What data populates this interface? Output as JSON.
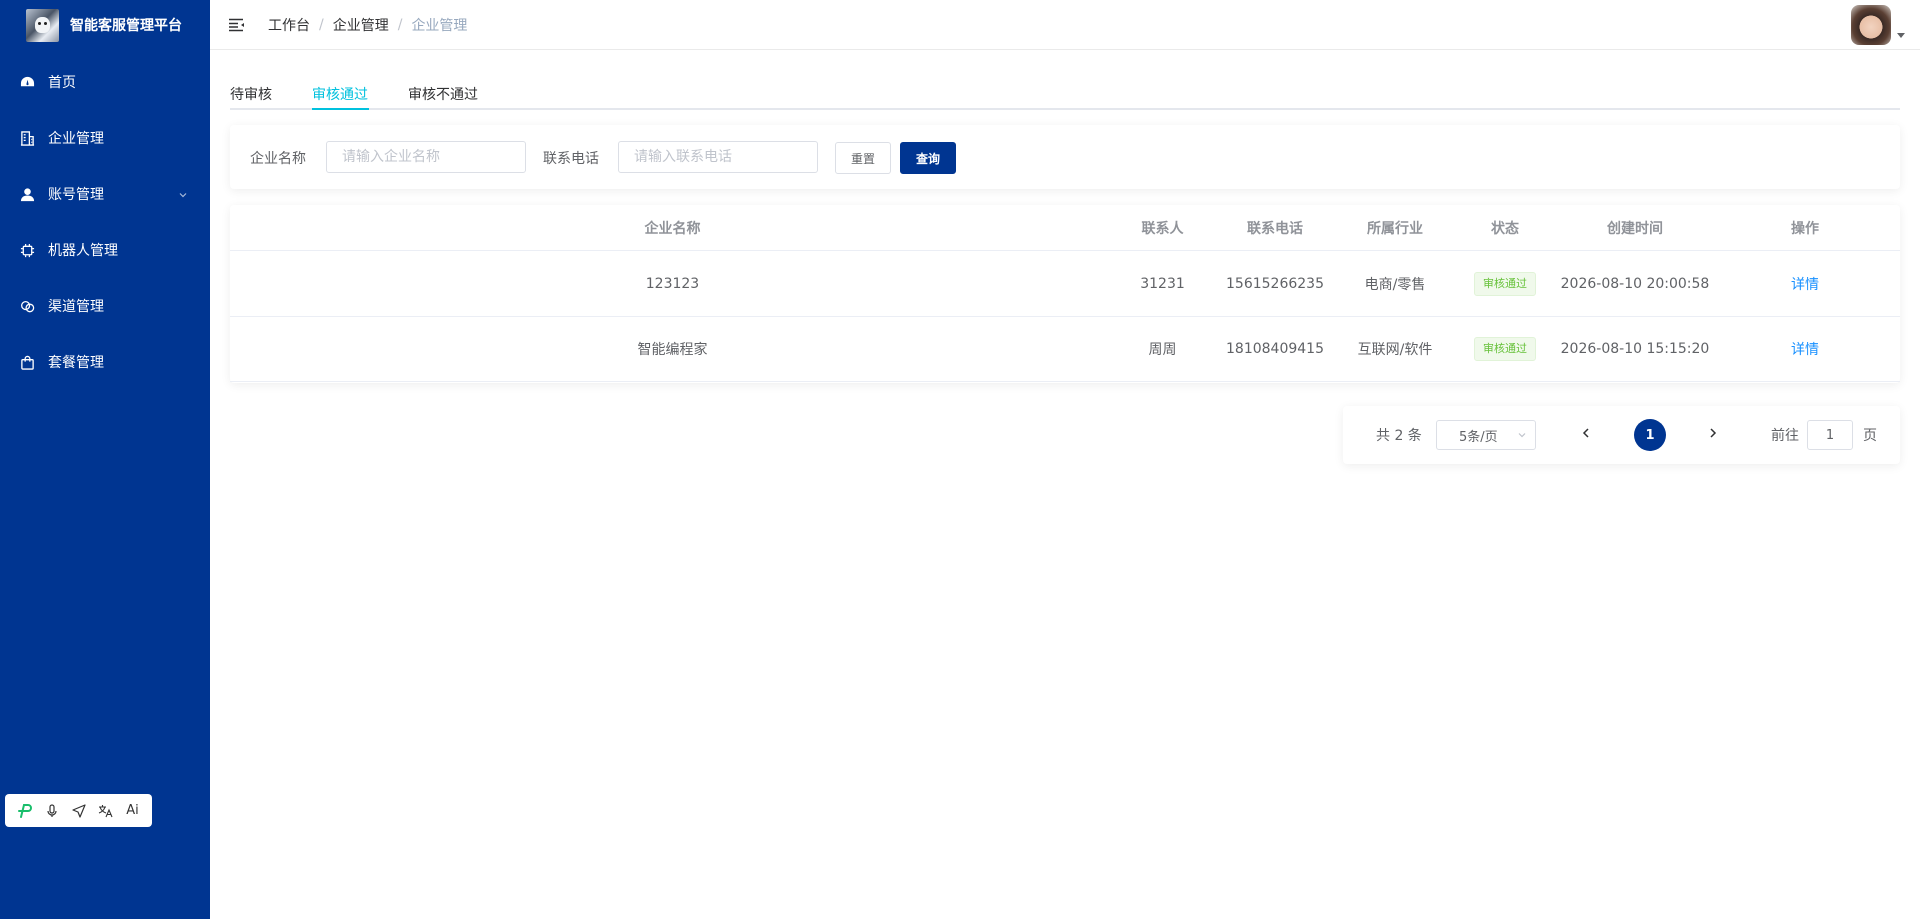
{
  "app": {
    "title": "智能客服管理平台"
  },
  "sidebar": {
    "items": [
      {
        "label": "首页",
        "icon": "dashboard-icon"
      },
      {
        "label": "企业管理",
        "icon": "building-icon"
      },
      {
        "label": "账号管理",
        "icon": "user-icon",
        "has_children": true
      },
      {
        "label": "机器人管理",
        "icon": "chip-icon"
      },
      {
        "label": "渠道管理",
        "icon": "channel-icon"
      },
      {
        "label": "套餐管理",
        "icon": "bag-icon"
      }
    ]
  },
  "float_toolbar": {
    "icons": [
      "brand-p-icon",
      "microphone-icon",
      "send-icon",
      "translate-icon",
      "ai-icon"
    ],
    "ai_label": "Ai"
  },
  "header": {
    "breadcrumb": [
      "工作台",
      "企业管理",
      "企业管理"
    ]
  },
  "tabs": [
    {
      "label": "待审核",
      "active": false
    },
    {
      "label": "审核通过",
      "active": true
    },
    {
      "label": "审核不通过",
      "active": false
    }
  ],
  "search": {
    "company_label": "企业名称",
    "company_placeholder": "请输入企业名称",
    "phone_label": "联系电话",
    "phone_placeholder": "请输入联系电话",
    "reset_label": "重置",
    "query_label": "查询"
  },
  "table": {
    "columns": [
      "企业名称",
      "联系人",
      "联系电话",
      "所属行业",
      "状态",
      "创建时间",
      "操作"
    ],
    "rows": [
      {
        "company": "123123",
        "contact": "31231",
        "phone": "15615266235",
        "industry": "电商/零售",
        "status": "审核通过",
        "created": "2026-08-10 20:00:58",
        "action": "详情"
      },
      {
        "company": "智能编程家",
        "contact": "周周",
        "phone": "18108409415",
        "industry": "互联网/软件",
        "status": "审核通过",
        "created": "2026-08-10 15:15:20",
        "action": "详情"
      }
    ]
  },
  "pagination": {
    "total_text": "共 2 条",
    "page_size": "5条/页",
    "current_page": "1",
    "goto_label": "前往",
    "goto_value": "1",
    "page_unit": "页"
  },
  "colors": {
    "sidebar_bg": "#003591",
    "accent_tab": "#00c1de",
    "primary_button": "#003591",
    "link": "#1890ff",
    "status_green": "#67c23a"
  }
}
